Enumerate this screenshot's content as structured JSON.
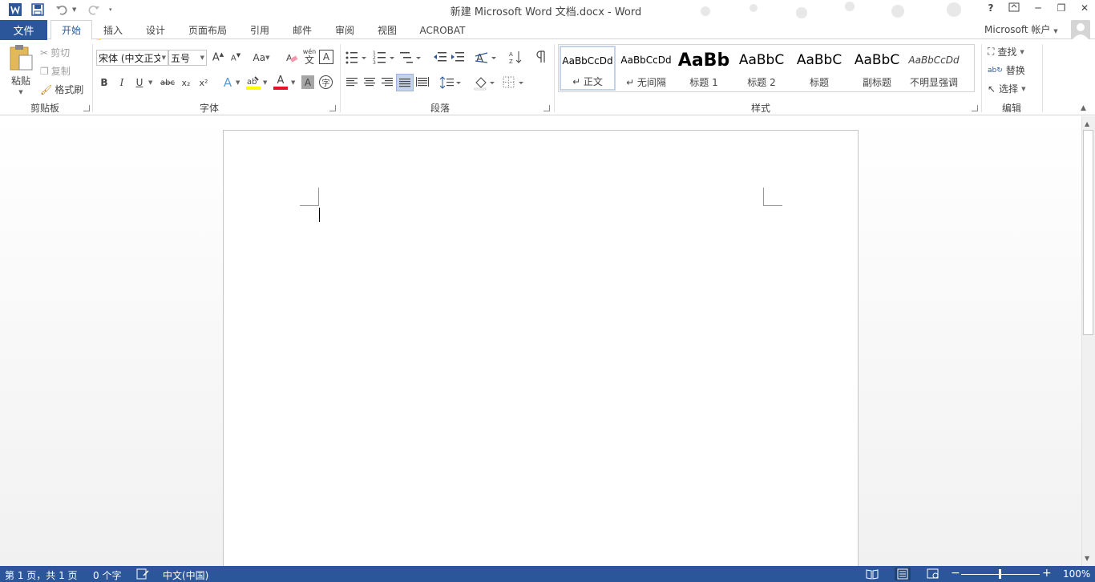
{
  "window": {
    "title": "新建 Microsoft Word 文档.docx - Word",
    "help": "?",
    "minimize": "─",
    "maximize": "❐",
    "close": "✕"
  },
  "tabs": {
    "file": "文件",
    "home": "开始",
    "insert": "插入",
    "design": "设计",
    "layout": "页面布局",
    "references": "引用",
    "mailings": "邮件",
    "review": "审阅",
    "view": "视图",
    "acrobat": "ACROBAT"
  },
  "account": "Microsoft 帐户",
  "clipboard": {
    "paste": "粘贴",
    "cut": "剪切",
    "copy": "复制",
    "format_painter": "格式刷",
    "group_label": "剪贴板"
  },
  "font": {
    "font_name": "宋体 (中文正文",
    "font_size": "五号",
    "change_case": "Aa",
    "bold": "B",
    "italic": "I",
    "underline": "U",
    "strike": "abc",
    "subscript": "x₂",
    "superscript": "x²",
    "phonetic": "wén",
    "phonetic_char": "文",
    "char_border": "A",
    "text_effects": "A",
    "font_color": "A",
    "char_shading": "A",
    "enclose": "字",
    "group_label": "字体"
  },
  "paragraph": {
    "group_label": "段落"
  },
  "styles": {
    "items": [
      {
        "preview": "AaBbCcDd",
        "name": "↵ 正文"
      },
      {
        "preview": "AaBbCcDd",
        "name": "↵ 无间隔"
      },
      {
        "preview": "AaBb",
        "name": "标题 1"
      },
      {
        "preview": "AaBbC",
        "name": "标题 2"
      },
      {
        "preview": "AaBbC",
        "name": "标题"
      },
      {
        "preview": "AaBbC",
        "name": "副标题"
      },
      {
        "preview": "AaBbCcDd",
        "name": "不明显强调"
      }
    ],
    "group_label": "样式"
  },
  "editing": {
    "find": "查找",
    "replace": "替换",
    "select": "选择",
    "group_label": "编辑"
  },
  "statusbar": {
    "page": "第 1 页，共 1 页",
    "words": "0 个字",
    "language": "中文(中国)",
    "zoom": "100%"
  },
  "colors": {
    "accent": "#2b579a",
    "highlight": "#ffff00",
    "font_color": "#e81123"
  }
}
